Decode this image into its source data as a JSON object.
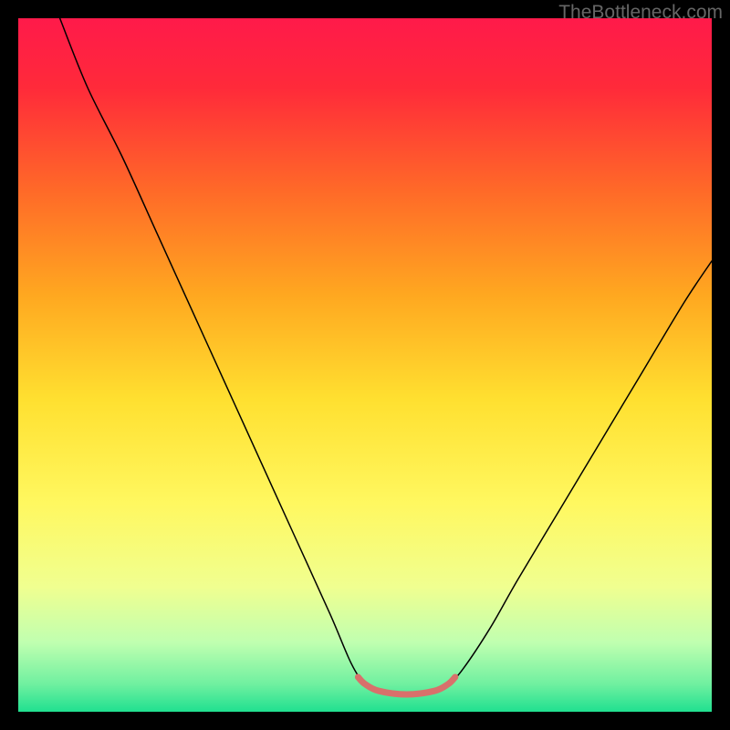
{
  "watermark": "TheBottleneck.com",
  "chart_data": {
    "type": "line",
    "title": "",
    "xlabel": "",
    "ylabel": "",
    "xlim": [
      0,
      100
    ],
    "ylim": [
      0,
      100
    ],
    "background_gradient": {
      "stops": [
        {
          "offset": 0.0,
          "color": "#ff1a4a"
        },
        {
          "offset": 0.1,
          "color": "#ff2a3a"
        },
        {
          "offset": 0.25,
          "color": "#ff6a28"
        },
        {
          "offset": 0.4,
          "color": "#ffa820"
        },
        {
          "offset": 0.55,
          "color": "#ffe030"
        },
        {
          "offset": 0.7,
          "color": "#fff860"
        },
        {
          "offset": 0.82,
          "color": "#f0ff90"
        },
        {
          "offset": 0.9,
          "color": "#c0ffb0"
        },
        {
          "offset": 0.96,
          "color": "#70f0a0"
        },
        {
          "offset": 1.0,
          "color": "#20e090"
        }
      ]
    },
    "series": [
      {
        "name": "curve",
        "color": "#000000",
        "stroke_width": 1.5,
        "points": [
          {
            "x": 6,
            "y": 100
          },
          {
            "x": 10,
            "y": 90
          },
          {
            "x": 15,
            "y": 80
          },
          {
            "x": 20,
            "y": 69
          },
          {
            "x": 25,
            "y": 58
          },
          {
            "x": 30,
            "y": 47
          },
          {
            "x": 35,
            "y": 36
          },
          {
            "x": 40,
            "y": 25
          },
          {
            "x": 45,
            "y": 14
          },
          {
            "x": 48,
            "y": 7
          },
          {
            "x": 50,
            "y": 4
          },
          {
            "x": 52,
            "y": 3
          },
          {
            "x": 56,
            "y": 2.5
          },
          {
            "x": 60,
            "y": 3
          },
          {
            "x": 62,
            "y": 4
          },
          {
            "x": 64,
            "y": 6
          },
          {
            "x": 68,
            "y": 12
          },
          {
            "x": 72,
            "y": 19
          },
          {
            "x": 78,
            "y": 29
          },
          {
            "x": 84,
            "y": 39
          },
          {
            "x": 90,
            "y": 49
          },
          {
            "x": 96,
            "y": 59
          },
          {
            "x": 100,
            "y": 65
          }
        ]
      },
      {
        "name": "bottom-highlight",
        "color": "#d9706b",
        "stroke_width": 7,
        "points": [
          {
            "x": 49,
            "y": 5
          },
          {
            "x": 50,
            "y": 4
          },
          {
            "x": 52,
            "y": 3
          },
          {
            "x": 56,
            "y": 2.5
          },
          {
            "x": 60,
            "y": 3
          },
          {
            "x": 62,
            "y": 4
          },
          {
            "x": 63,
            "y": 5
          }
        ]
      }
    ]
  }
}
